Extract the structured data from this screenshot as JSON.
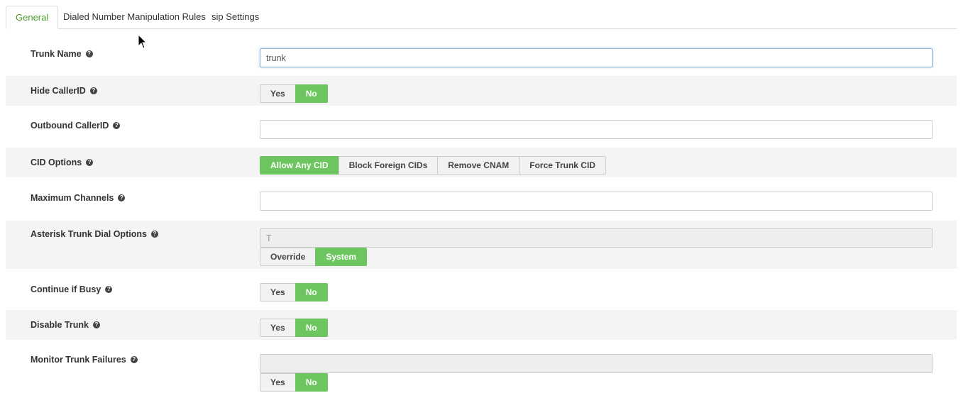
{
  "tabs": [
    {
      "label": "General",
      "active": true
    },
    {
      "label": "Dialed Number Manipulation Rules",
      "active": false
    },
    {
      "label": "sip Settings",
      "active": false
    }
  ],
  "fields": {
    "trunk_name": {
      "label": "Trunk Name",
      "value": "trunk"
    },
    "hide_callerid": {
      "label": "Hide CallerID",
      "options": [
        "Yes",
        "No"
      ],
      "selected": "No"
    },
    "outbound_callerid": {
      "label": "Outbound CallerID",
      "value": ""
    },
    "cid_options": {
      "label": "CID Options",
      "options": [
        "Allow Any CID",
        "Block Foreign CIDs",
        "Remove CNAM",
        "Force Trunk CID"
      ],
      "selected": "Allow Any CID"
    },
    "max_channels": {
      "label": "Maximum Channels",
      "value": ""
    },
    "dial_options": {
      "label": "Asterisk Trunk Dial Options",
      "value": "T",
      "options": [
        "Override",
        "System"
      ],
      "selected": "System"
    },
    "continue_busy": {
      "label": "Continue if Busy",
      "options": [
        "Yes",
        "No"
      ],
      "selected": "No"
    },
    "disable_trunk": {
      "label": "Disable Trunk",
      "options": [
        "Yes",
        "No"
      ],
      "selected": "No"
    },
    "monitor_failures": {
      "label": "Monitor Trunk Failures",
      "value": "",
      "options": [
        "Yes",
        "No"
      ],
      "selected": "No"
    }
  },
  "help_glyph": "?",
  "colors": {
    "accent": "#6cc55e",
    "active_tab_text": "#4c9d2f",
    "row_shade": "#f4f4f4"
  }
}
